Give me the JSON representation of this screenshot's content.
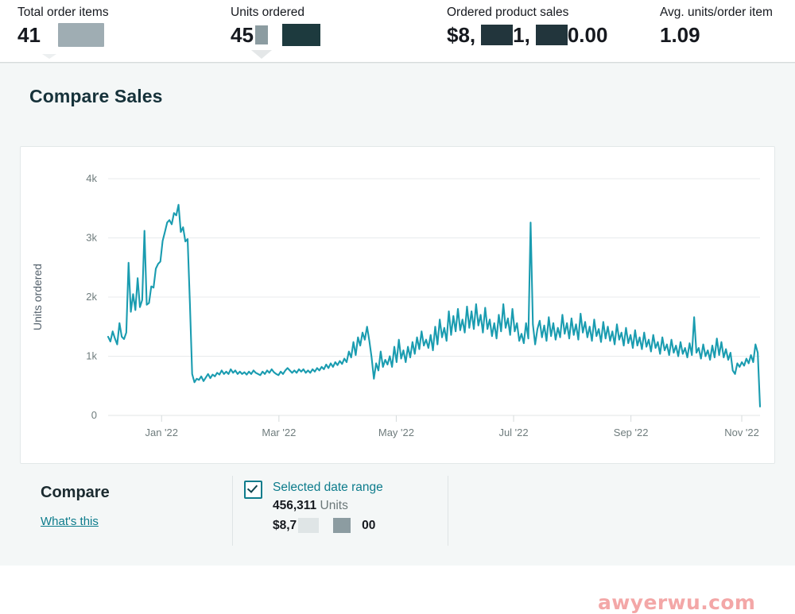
{
  "kpis": [
    {
      "label": "Total order items",
      "value_visible": "41",
      "redactions": [
        "grey-block"
      ]
    },
    {
      "label": "Units ordered",
      "value_visible": "45",
      "redactions": [
        "grey-block",
        "dark-block"
      ]
    },
    {
      "label": "Ordered product sales",
      "value_visible": "$8,  1,  0.00",
      "redactions": [
        "dark-block",
        "dark-block"
      ]
    },
    {
      "label": "Avg. units/order item",
      "value_visible": "1.09",
      "redactions": []
    }
  ],
  "section": {
    "title": "Compare Sales"
  },
  "compare": {
    "heading": "Compare",
    "help_link": "What's this"
  },
  "legend": {
    "checked": true,
    "title": "Selected date range",
    "units_value": "456,311",
    "units_suffix": "Units",
    "money_prefix": "$8,7",
    "money_suffix": "00"
  },
  "watermark": "awyerwu.com",
  "colors": {
    "line": "#1a9cb0",
    "accent": "#0d7c8c",
    "page_bg": "#f4f7f7",
    "card_bg": "#ffffff",
    "text": "#16191f",
    "watermark": "#f3a7a7"
  },
  "chart_data": {
    "type": "line",
    "title": "",
    "xlabel": "",
    "ylabel": "Units ordered",
    "ylim": [
      0,
      4000
    ],
    "yticks": [
      0,
      1000,
      2000,
      3000,
      4000
    ],
    "ytick_labels": [
      "0",
      "1k",
      "2k",
      "3k",
      "4k"
    ],
    "xtick_labels": [
      "Jan '22",
      "Mar '22",
      "May '22",
      "Jul '22",
      "Sep '22",
      "Nov '22"
    ],
    "xtick_positions": [
      0.082,
      0.262,
      0.442,
      0.622,
      0.802,
      0.972
    ],
    "grid": true,
    "legend_position": "bottom",
    "series": [
      {
        "name": "Selected date range",
        "color": "#1a9cb0",
        "values": [
          1330,
          1250,
          1420,
          1300,
          1200,
          1560,
          1330,
          1290,
          1400,
          2580,
          1750,
          2050,
          1780,
          2320,
          1830,
          1950,
          3120,
          1870,
          1900,
          2180,
          2160,
          2480,
          2560,
          2600,
          2950,
          3100,
          3260,
          3300,
          3230,
          3420,
          3380,
          3560,
          3100,
          3180,
          2940,
          2980,
          1900,
          700,
          560,
          620,
          600,
          660,
          580,
          640,
          700,
          630,
          690,
          660,
          720,
          690,
          760,
          700,
          740,
          700,
          780,
          720,
          760,
          700,
          740,
          700,
          730,
          690,
          740,
          700,
          760,
          720,
          700,
          680,
          740,
          700,
          760,
          720,
          780,
          730,
          700,
          680,
          740,
          700,
          760,
          800,
          760,
          720,
          760,
          720,
          780,
          740,
          780,
          720,
          760,
          720,
          780,
          740,
          800,
          760,
          820,
          780,
          860,
          800,
          880,
          820,
          900,
          850,
          920,
          870,
          960,
          900,
          1080,
          980,
          1240,
          1020,
          1320,
          1180,
          1400,
          1280,
          1500,
          1260,
          980,
          620,
          880,
          760,
          1080,
          820,
          940,
          860,
          1000,
          820,
          1160,
          900,
          1280,
          960,
          1100,
          900,
          1160,
          980,
          1240,
          1040,
          1320,
          1120,
          1420,
          1180,
          1280,
          1140,
          1360,
          1100,
          1500,
          1200,
          1620,
          1320,
          1480,
          1260,
          1760,
          1360,
          1680,
          1420,
          1800,
          1440,
          1620,
          1400,
          1840,
          1480,
          1760,
          1460,
          1880,
          1520,
          1700,
          1400,
          1820,
          1460,
          1620,
          1340,
          1560,
          1300,
          1700,
          1420,
          1880,
          1480,
          1640,
          1360,
          1800,
          1420,
          1560,
          1260,
          1380,
          1220,
          1560,
          1300,
          3260,
          1540,
          1200,
          1460,
          1600,
          1320,
          1520,
          1260,
          1660,
          1340,
          1560,
          1280,
          1480,
          1320,
          1700,
          1380,
          1560,
          1300,
          1640,
          1360,
          1540,
          1280,
          1720,
          1400,
          1580,
          1320,
          1500,
          1260,
          1620,
          1340,
          1460,
          1240,
          1580,
          1300,
          1500,
          1260,
          1420,
          1200,
          1540,
          1280,
          1400,
          1180,
          1480,
          1220,
          1360,
          1140,
          1440,
          1180,
          1320,
          1120,
          1400,
          1160,
          1280,
          1080,
          1360,
          1140,
          1240,
          1040,
          1320,
          1100,
          1200,
          1020,
          1280,
          1060,
          1180,
          1000,
          1240,
          1040,
          1140,
          980,
          1220,
          1020,
          1660,
          1060,
          1140,
          960,
          1200,
          1000,
          1100,
          940,
          1180,
          980,
          1300,
          1020,
          1240,
          980,
          1120,
          940,
          1060,
          760,
          700,
          880,
          820,
          900,
          840,
          960,
          880,
          1020,
          900,
          1200,
          1060,
          150
        ]
      }
    ]
  }
}
